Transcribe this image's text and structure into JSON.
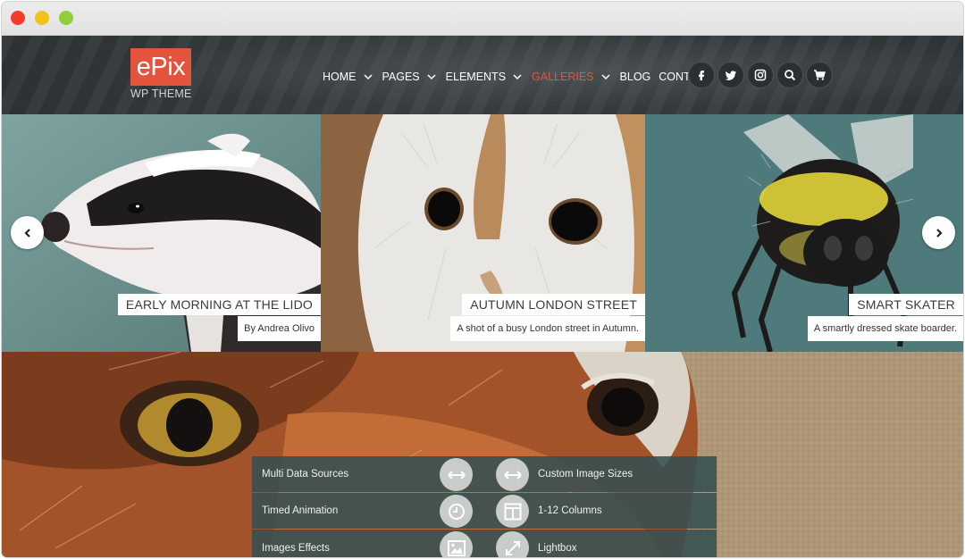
{
  "logo": {
    "main": "ePix",
    "sub": "WP THEME"
  },
  "nav": {
    "items": [
      {
        "label": "HOME",
        "dropdown": true,
        "active": false
      },
      {
        "label": "PAGES",
        "dropdown": true,
        "active": false
      },
      {
        "label": "ELEMENTS",
        "dropdown": true,
        "active": false
      },
      {
        "label": "GALLERIES",
        "dropdown": true,
        "active": true
      },
      {
        "label": "BLOG",
        "dropdown": false,
        "active": false
      },
      {
        "label": "CONTACT",
        "dropdown": false,
        "active": false
      }
    ],
    "social_icons": [
      "facebook-icon",
      "twitter-icon",
      "instagram-icon",
      "search-icon",
      "cart-icon"
    ]
  },
  "slides": [
    {
      "title": "EARLY MORNING AT THE LIDO",
      "subtitle": "By Andrea Olivo"
    },
    {
      "title": "AUTUMN LONDON STREET",
      "subtitle": "A shot of a busy London street in Autumn."
    },
    {
      "title": "SMART SKATER",
      "subtitle": "A smartly dressed skate boarder."
    }
  ],
  "features": {
    "left": [
      "Multi Data Sources",
      "Timed Animation",
      "Images Effects"
    ],
    "right": [
      "Custom Image Sizes",
      "1-12 Columns",
      "Lightbox"
    ],
    "left_icons": [
      "horizontal-arrows-icon",
      "clock-icon",
      "image-icon"
    ],
    "right_icons": [
      "horizontal-arrows-icon",
      "columns-icon",
      "expand-icon"
    ]
  },
  "colors": {
    "accent": "#e3543c",
    "header_bg": "#363c3e",
    "feature_bg": "#344e51",
    "feature_icon_bg": "#c9cdc9"
  }
}
